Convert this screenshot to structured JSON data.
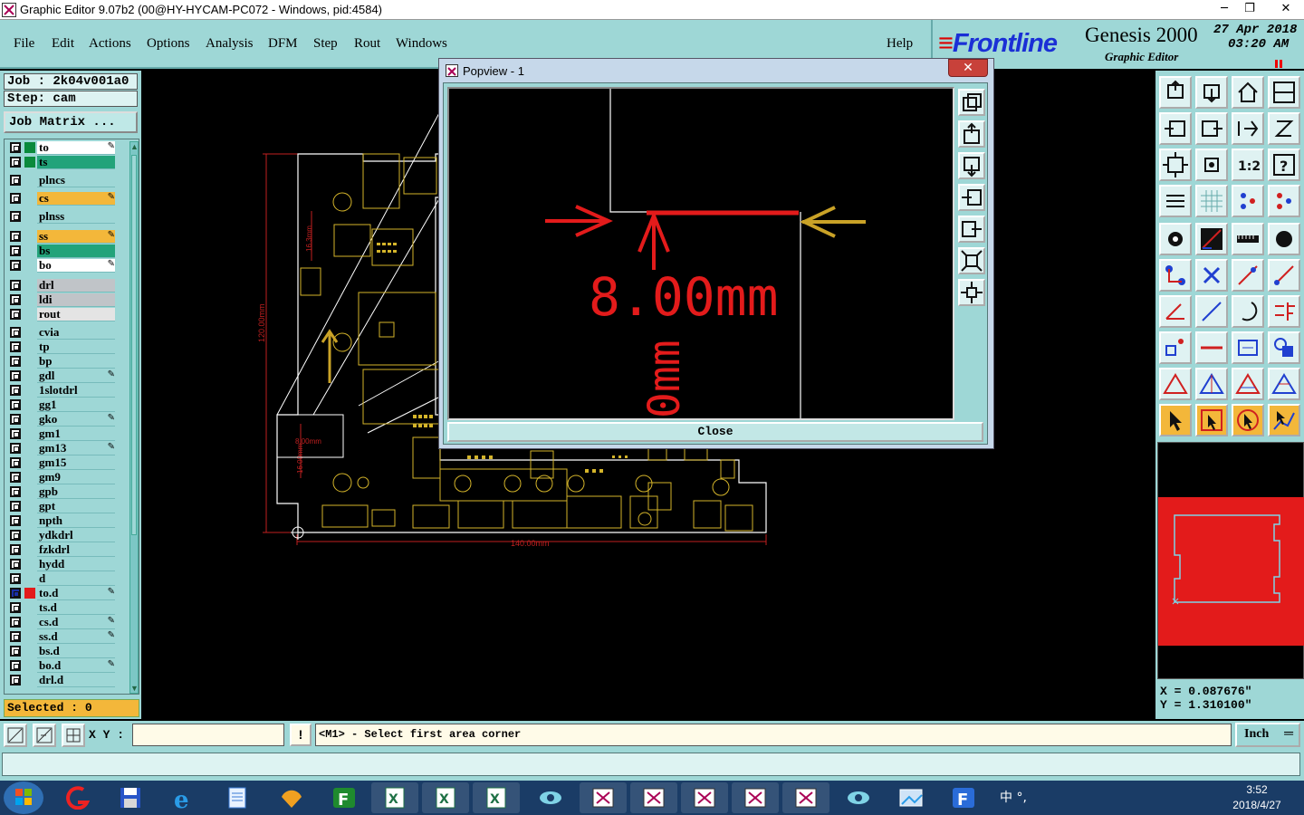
{
  "window": {
    "title": "Graphic Editor 9.07b2 (00@HY-HYCAM-PC072 - Windows, pid:4584)",
    "min": "─",
    "max": "❐",
    "close": "✕"
  },
  "menu": [
    "File",
    "Edit",
    "Actions",
    "Options",
    "Analysis",
    "DFM",
    "Step",
    "Rout",
    "Windows"
  ],
  "help": "Help",
  "brand": {
    "logo": "Frontline",
    "product": "Genesis 2000",
    "subtitle": "Graphic Editor",
    "date": "27 Apr 2018",
    "time": "03:20 AM"
  },
  "job": {
    "job_label": "Job : 2k04v001a0",
    "step_label": "Step: cam",
    "matrix_button": "Job Matrix ..."
  },
  "layers": [
    {
      "name": "to",
      "color": "#ffffff",
      "swatch": "#0a8a3c",
      "edit": true
    },
    {
      "name": "ts",
      "color": "#22a37a",
      "swatch": "#0a8a3c",
      "edit": false
    },
    {
      "name": "plncs",
      "color": "#9ed7d6",
      "swatch": "",
      "edit": false
    },
    {
      "name": "cs",
      "color": "#f3b73a",
      "swatch": "",
      "edit": true
    },
    {
      "name": "plnss",
      "color": "#9ed7d6",
      "swatch": "",
      "edit": false
    },
    {
      "name": "ss",
      "color": "#f3b73a",
      "swatch": "",
      "edit": true
    },
    {
      "name": "bs",
      "color": "#22a37a",
      "swatch": "",
      "edit": false
    },
    {
      "name": "bo",
      "color": "#ffffff",
      "swatch": "",
      "edit": true
    },
    {
      "name": "drl",
      "color": "#c0c4c8",
      "swatch": "",
      "edit": false
    },
    {
      "name": "ldi",
      "color": "#c0c4c8",
      "swatch": "",
      "edit": false
    },
    {
      "name": "rout",
      "color": "#e4e4e4",
      "swatch": "",
      "edit": false
    },
    {
      "name": "cvia",
      "color": "#9ed7d6",
      "swatch": "",
      "edit": false
    },
    {
      "name": "tp",
      "color": "#9ed7d6",
      "swatch": "",
      "edit": false
    },
    {
      "name": "bp",
      "color": "#9ed7d6",
      "swatch": "",
      "edit": false
    },
    {
      "name": "gdl",
      "color": "#9ed7d6",
      "swatch": "",
      "edit": true
    },
    {
      "name": "1slotdrl",
      "color": "#9ed7d6",
      "swatch": "",
      "edit": false
    },
    {
      "name": "gg1",
      "color": "#9ed7d6",
      "swatch": "",
      "edit": false
    },
    {
      "name": "gko",
      "color": "#9ed7d6",
      "swatch": "",
      "edit": true
    },
    {
      "name": "gm1",
      "color": "#9ed7d6",
      "swatch": "",
      "edit": false
    },
    {
      "name": "gm13",
      "color": "#9ed7d6",
      "swatch": "",
      "edit": true
    },
    {
      "name": "gm15",
      "color": "#9ed7d6",
      "swatch": "",
      "edit": false
    },
    {
      "name": "gm9",
      "color": "#9ed7d6",
      "swatch": "",
      "edit": false
    },
    {
      "name": "gpb",
      "color": "#9ed7d6",
      "swatch": "",
      "edit": false
    },
    {
      "name": "gpt",
      "color": "#9ed7d6",
      "swatch": "",
      "edit": false
    },
    {
      "name": "npth",
      "color": "#9ed7d6",
      "swatch": "",
      "edit": false
    },
    {
      "name": "ydkdrl",
      "color": "#9ed7d6",
      "swatch": "",
      "edit": false
    },
    {
      "name": "fzkdrl",
      "color": "#9ed7d6",
      "swatch": "",
      "edit": false
    },
    {
      "name": "hydd",
      "color": "#9ed7d6",
      "swatch": "",
      "edit": false
    },
    {
      "name": "d",
      "color": "#9ed7d6",
      "swatch": "",
      "edit": false
    },
    {
      "name": "to.d",
      "color": "#9ed7d6",
      "swatch": "#e31b1b",
      "edit": true
    },
    {
      "name": "ts.d",
      "color": "#9ed7d6",
      "swatch": "",
      "edit": false
    },
    {
      "name": "cs.d",
      "color": "#9ed7d6",
      "swatch": "",
      "edit": true
    },
    {
      "name": "ss.d",
      "color": "#9ed7d6",
      "swatch": "",
      "edit": true
    },
    {
      "name": "bs.d",
      "color": "#9ed7d6",
      "swatch": "",
      "edit": false
    },
    {
      "name": "bo.d",
      "color": "#9ed7d6",
      "swatch": "",
      "edit": true
    },
    {
      "name": "drl.d",
      "color": "#9ed7d6",
      "swatch": "",
      "edit": false
    }
  ],
  "selected": "Selected : 0",
  "board": {
    "dim_height": "120.00mm",
    "dim_width": "140.00mm",
    "dim_small": "16.3mm",
    "dim_small2": "16.00mm",
    "dim_small3": "8.00mm"
  },
  "popview": {
    "title": "Popview - 1",
    "close_x": "✕",
    "dimension_text": "8.00mm",
    "vertical_text": "0mm",
    "close_button": "Close"
  },
  "coords": {
    "x": "X = 0.087676\"",
    "y": "Y = 1.310100\""
  },
  "command": {
    "xy_label": "X Y :",
    "xy_value": "",
    "bang": "!",
    "prompt": "<M1> - Select first area corner",
    "unit": "Inch"
  },
  "taskbar": {
    "clock_time": "3:52",
    "clock_date": "2018/4/27",
    "tray": "中 °,"
  },
  "colors": {
    "panel": "#9ed7d6",
    "accent_red": "#e31b1b",
    "accent_gold": "#c9a227",
    "board_outline": "#ffffff"
  }
}
